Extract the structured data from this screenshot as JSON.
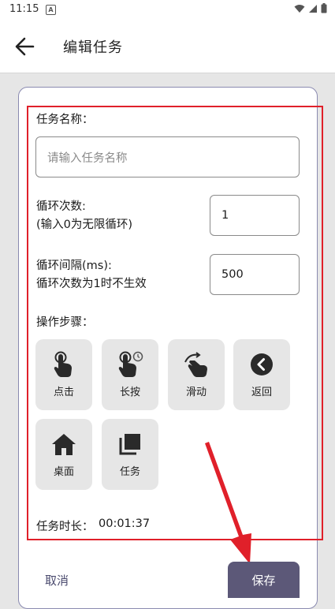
{
  "status_bar": {
    "time": "11:15",
    "notification_letter": "A"
  },
  "header": {
    "title": "编辑任务",
    "back_icon": "arrow-left-icon"
  },
  "form": {
    "task_name_label": "任务名称：",
    "task_name_value": "",
    "task_name_placeholder": "请输入任务名称",
    "loop_count_label_line1": "循环次数:",
    "loop_count_label_line2": "(输入0为无限循环)",
    "loop_count_value": "1",
    "loop_interval_label_line1": "循环间隔(ms):",
    "loop_interval_label_line2": "循环次数为1时不生效",
    "loop_interval_value": "500",
    "steps_label": "操作步骤：",
    "steps": [
      {
        "label": "点击",
        "icon": "tap-hand-icon"
      },
      {
        "label": "长按",
        "icon": "long-press-hand-icon"
      },
      {
        "label": "滑动",
        "icon": "swipe-hand-icon"
      },
      {
        "label": "返回",
        "icon": "back-circle-icon"
      },
      {
        "label": "桌面",
        "icon": "home-icon"
      },
      {
        "label": "任务",
        "icon": "task-stack-icon"
      }
    ],
    "duration_label": "任务时长：",
    "duration_value": "00:01:37"
  },
  "actions": {
    "cancel_label": "取消",
    "save_label": "保存"
  },
  "colors": {
    "highlight_border": "#e0202a",
    "save_button_bg": "#5c5878",
    "card_border": "#8a8ab0",
    "step_button_bg": "#e6e6e6"
  }
}
